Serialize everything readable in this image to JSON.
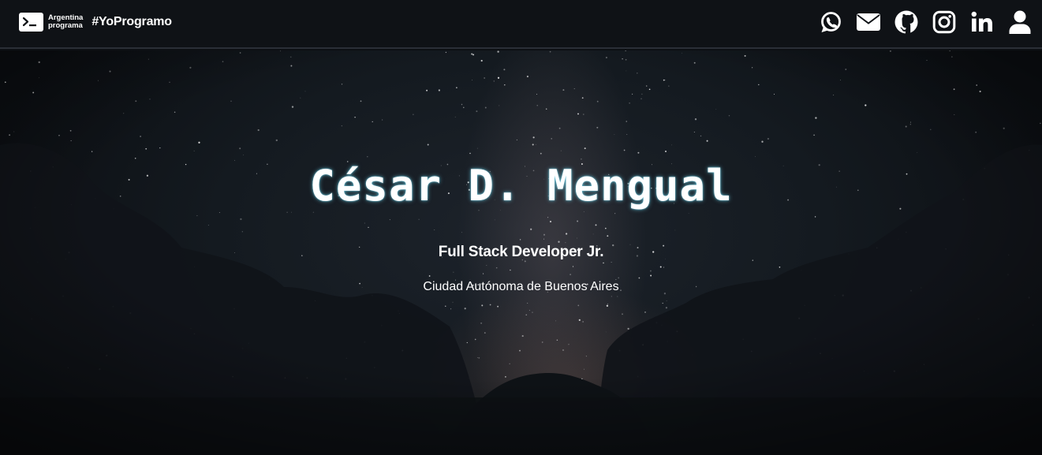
{
  "header": {
    "brand_line1": "Argentina",
    "brand_line2": "programa",
    "hashtag": "#YoProgramo",
    "social": [
      {
        "name": "whatsapp-icon"
      },
      {
        "name": "email-icon"
      },
      {
        "name": "github-icon"
      },
      {
        "name": "instagram-icon"
      },
      {
        "name": "linkedin-icon"
      },
      {
        "name": "user-icon"
      }
    ]
  },
  "hero": {
    "name": "César D. Mengual",
    "role": "Full Stack Developer Jr.",
    "location": "Ciudad Autónoma de Buenos Aires"
  },
  "colors": {
    "header_bg": "#0f1216",
    "header_border": "#2a2e36",
    "text": "#ffffff",
    "name_glow": "#78e6ff"
  }
}
